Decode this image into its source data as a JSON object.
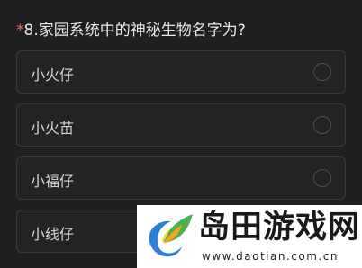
{
  "question": {
    "required_mark": "*",
    "text": "8.家园系统中的神秘生物名字为?"
  },
  "options": [
    {
      "label": "小火仔"
    },
    {
      "label": "小火苗"
    },
    {
      "label": "小福仔"
    },
    {
      "label": "小线仔"
    }
  ],
  "watermark": {
    "title": "岛田游戏网",
    "url": "www.daotian.com.cn"
  },
  "colors": {
    "background": "#1f1f21",
    "required": "#f26b5b",
    "text": "#e9e9ea",
    "option_border": "#3b3b3e",
    "logo_green": "#4caf50",
    "logo_orange": "#f5a623",
    "logo_blue": "#2f7fd8"
  }
}
